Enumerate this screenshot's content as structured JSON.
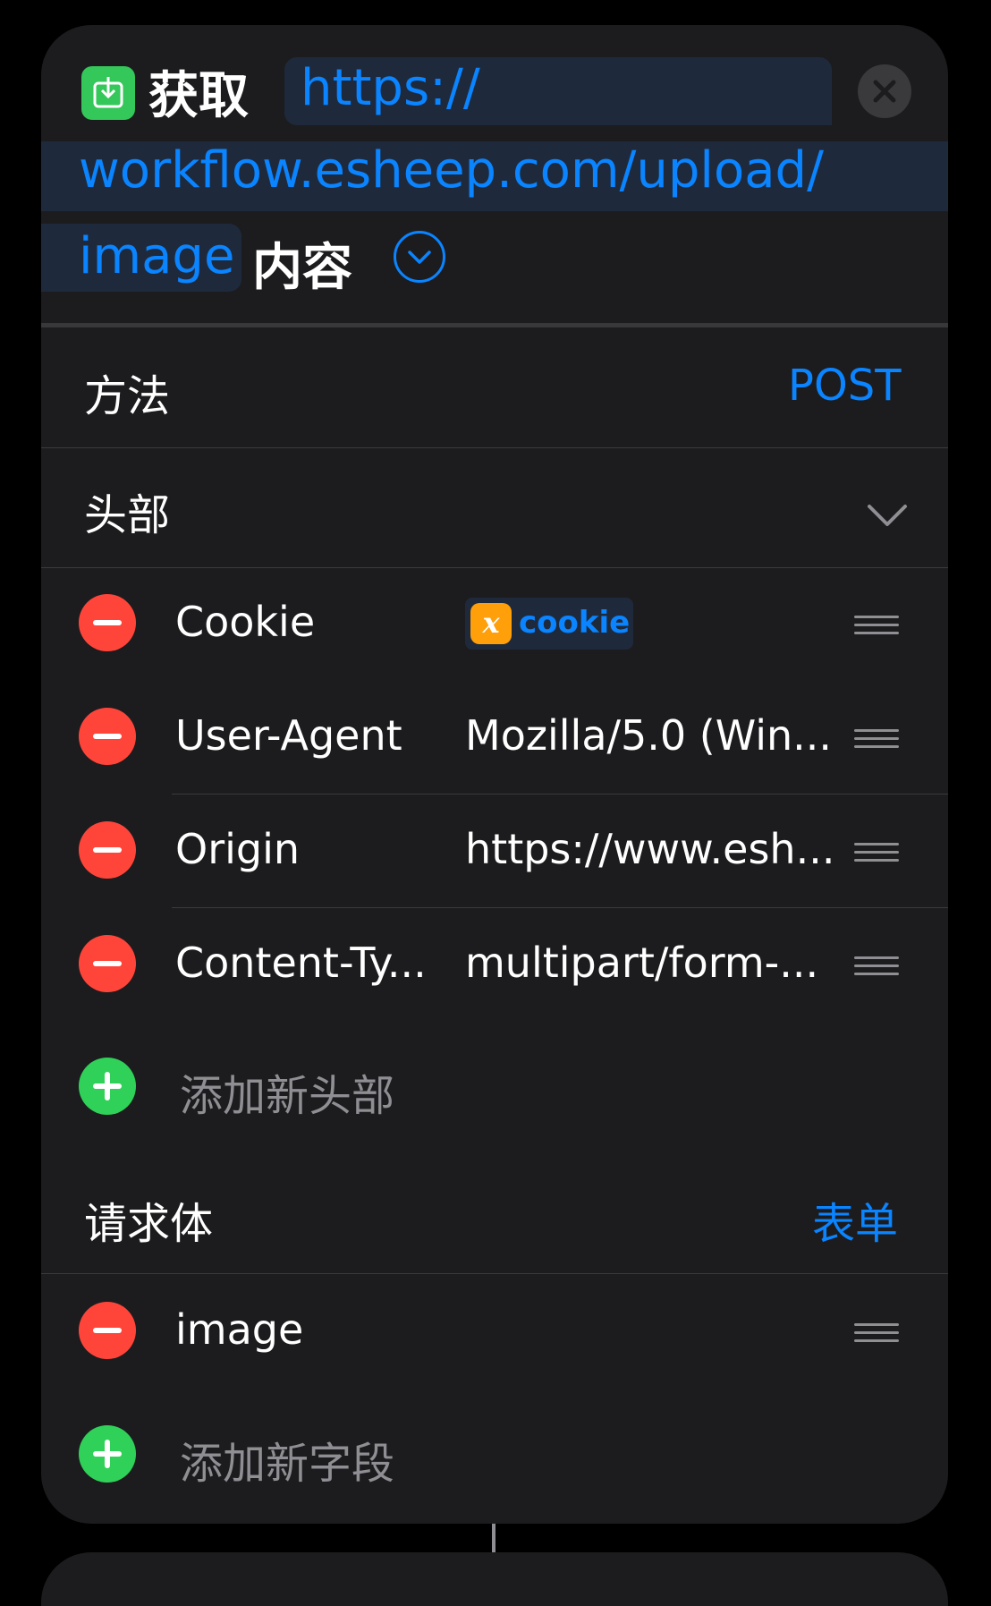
{
  "action": {
    "title": "获取",
    "url_line1": "https://",
    "url_line2": "workflow.esheep.com/upload/",
    "url_line3": "image",
    "suffix": "内容"
  },
  "method": {
    "label": "方法",
    "value": "POST"
  },
  "headers": {
    "label": "头部",
    "items": [
      {
        "key": "Cookie",
        "value": "",
        "variable": "cookie"
      },
      {
        "key": "User-Agent",
        "value": "Mozilla/5.0 (Win..."
      },
      {
        "key": "Origin",
        "value": "https://www.esh..."
      },
      {
        "key": "Content-Ty...",
        "value": "multipart/form-..."
      }
    ],
    "add_label": "添加新头部"
  },
  "body": {
    "label": "请求体",
    "value": "表单",
    "items": [
      {
        "key": "image"
      }
    ],
    "add_label": "添加新字段"
  },
  "icons": {
    "app": "download-box-icon",
    "close": "close-icon",
    "expand": "chevron-down-circle-icon",
    "collapse": "chevron-down-icon",
    "variable": "variable-x-icon",
    "remove": "minus-circle-icon",
    "add": "plus-circle-icon",
    "reorder": "reorder-handle-icon"
  },
  "colors": {
    "accent": "#0a84ff",
    "remove": "#ff453a",
    "add": "#30d158",
    "app_icon": "#34c759",
    "variable": "#ff9f0a"
  }
}
